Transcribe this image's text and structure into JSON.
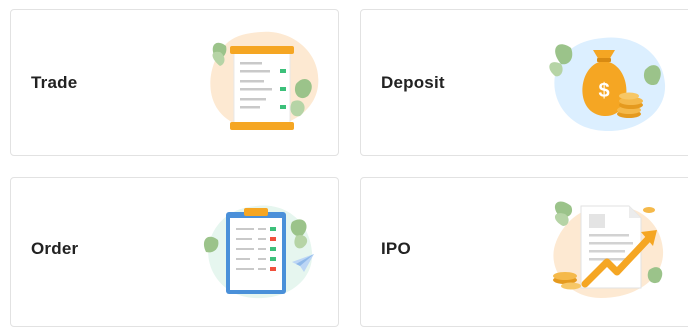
{
  "cards": [
    {
      "id": "trade",
      "label": "Trade",
      "icon": "trade-receipt-icon"
    },
    {
      "id": "deposit",
      "label": "Deposit",
      "icon": "money-bag-icon"
    },
    {
      "id": "order",
      "label": "Order",
      "icon": "clipboard-order-icon"
    },
    {
      "id": "ipo",
      "label": "IPO",
      "icon": "ipo-chart-icon"
    }
  ],
  "colors": {
    "card_border": "#e2e2e2",
    "label_text": "#222222",
    "accent_orange": "#f5a623",
    "leaf_green": "#9bc38a",
    "sell_red": "#f0503c",
    "buy_green": "#3cc07a",
    "blob_peach": "#fde9d2",
    "blob_blue": "#dcefff",
    "blob_mint": "#e6f6ef"
  }
}
